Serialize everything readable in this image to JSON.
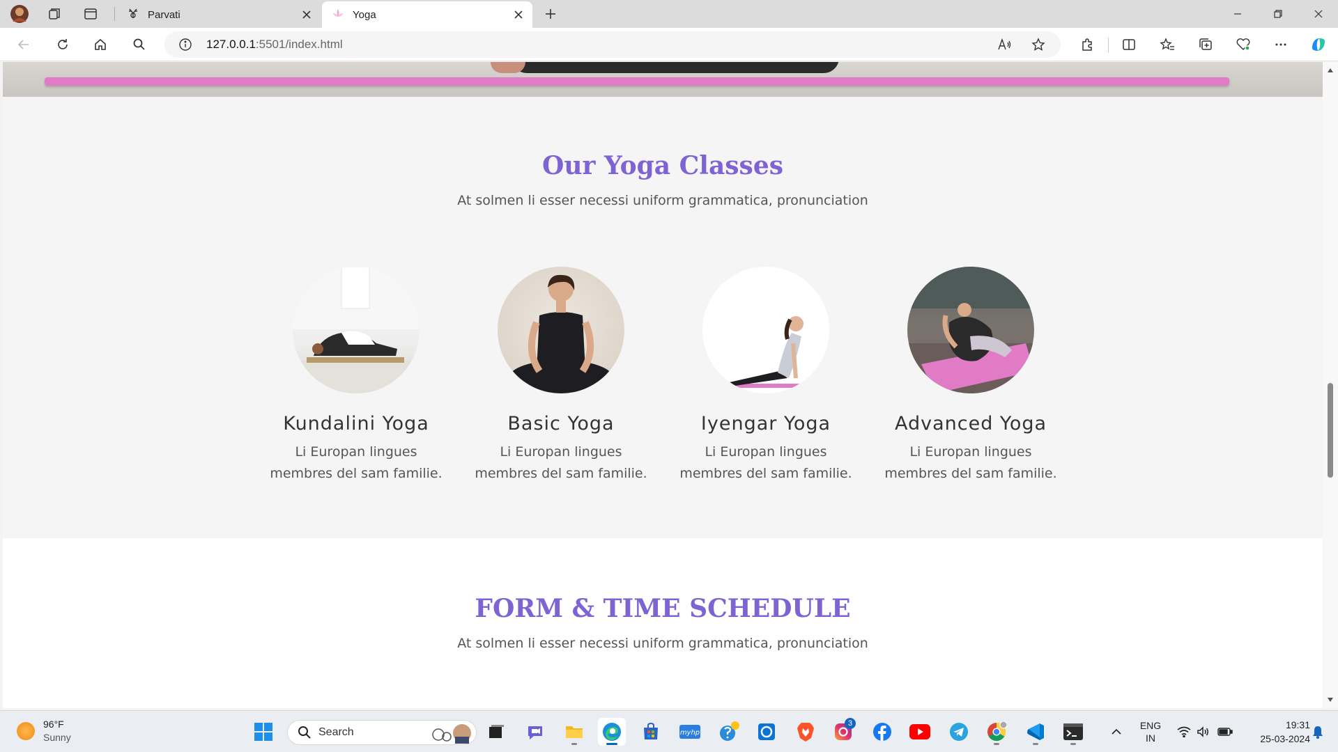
{
  "browser": {
    "tabs": [
      {
        "title": "Parvati",
        "active": false
      },
      {
        "title": "Yoga",
        "active": true
      }
    ],
    "url_host": "127.0.0.1",
    "url_path": ":5501/index.html"
  },
  "page": {
    "classes_section": {
      "title": "Our Yoga Classes",
      "subtitle": "At solmen li esser necessi uniform grammatica, pronunciation",
      "cards": [
        {
          "name": "Kundalini Yoga",
          "desc_line1": "Li Europan lingues",
          "desc_line2": "membres del sam familie."
        },
        {
          "name": "Basic Yoga",
          "desc_line1": "Li Europan lingues",
          "desc_line2": "membres del sam familie."
        },
        {
          "name": "Iyengar Yoga",
          "desc_line1": "Li Europan lingues",
          "desc_line2": "membres del sam familie."
        },
        {
          "name": "Advanced Yoga",
          "desc_line1": "Li Europan lingues",
          "desc_line2": "membres del sam familie."
        }
      ]
    },
    "schedule_section": {
      "title": "FORM & TIME SCHEDULE",
      "subtitle": "At solmen li esser necessi uniform grammatica, pronunciation"
    }
  },
  "taskbar": {
    "weather_temp": "96°F",
    "weather_cond": "Sunny",
    "search_label": "Search",
    "instagram_badge": "3",
    "lang_line1": "ENG",
    "lang_line2": "IN",
    "time": "19:31",
    "date": "25-03-2024"
  },
  "colors": {
    "heading_accent": "#7e63d3",
    "mat_pink": "#e27bc6",
    "taskbar_active": "#0067c0"
  }
}
